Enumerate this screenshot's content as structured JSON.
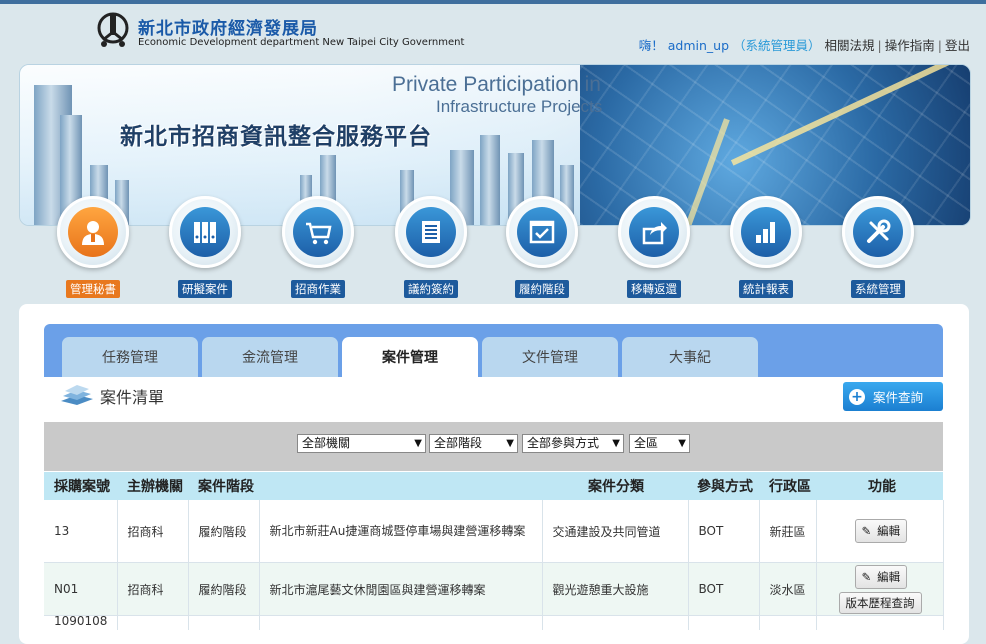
{
  "header": {
    "org_name_zh": "新北市政府經濟發展局",
    "org_name_en": "Economic Development department New Taipei City Government",
    "greeting": "嗨！",
    "username": "admin_up",
    "role": "（系統管理員）",
    "links": [
      "相關法規",
      "操作指南",
      "登出"
    ]
  },
  "banner": {
    "title_en_line1": "Private Participation in",
    "title_en_line2": "Infrastructure Projects",
    "title_zh": "新北市招商資訊整合服務平台"
  },
  "nav": {
    "items": [
      {
        "label": "管理秘書",
        "icon": "user-icon",
        "active": true
      },
      {
        "label": "研擬案件",
        "icon": "binders-icon",
        "active": false
      },
      {
        "label": "招商作業",
        "icon": "cart-icon",
        "active": false
      },
      {
        "label": "議約簽約",
        "icon": "list-icon",
        "active": false
      },
      {
        "label": "履約階段",
        "icon": "check-window-icon",
        "active": false
      },
      {
        "label": "移轉返還",
        "icon": "share-icon",
        "active": false
      },
      {
        "label": "統計報表",
        "icon": "bar-chart-icon",
        "active": false
      },
      {
        "label": "系統管理",
        "icon": "tools-icon",
        "active": false
      }
    ]
  },
  "tabs": [
    {
      "label": "任務管理"
    },
    {
      "label": "金流管理"
    },
    {
      "label": "案件管理",
      "active": true
    },
    {
      "label": "文件管理"
    },
    {
      "label": "大事紀"
    }
  ],
  "section": {
    "title": "案件清單",
    "query_button": "案件查詢"
  },
  "filters": {
    "agency": "全部機關",
    "stage": "全部階段",
    "participation": "全部參與方式",
    "district": "全區"
  },
  "table": {
    "headers": [
      "採購案號",
      "主辦機關",
      "案件階段",
      "",
      "案件分類",
      "參與方式",
      "行政區",
      "功能"
    ],
    "rows": [
      {
        "case_no": "13",
        "agency": "招商科",
        "stage": "履約階段",
        "name": "新北市新莊Au捷運商城暨停車場與建營運移轉案",
        "category": "交通建設及共同管道",
        "method": "BOT",
        "district": "新莊區",
        "actions": [
          "編輯"
        ]
      },
      {
        "case_no": "N01",
        "agency": "招商科",
        "stage": "履約階段",
        "name": "新北市滬尾藝文休閒園區與建營運移轉案",
        "category": "觀光遊憩重大設施",
        "method": "BOT",
        "district": "淡水區",
        "actions": [
          "編輯",
          "版本歷程查詢"
        ]
      },
      {
        "case_no": "1090108",
        "agency": "",
        "stage": "",
        "name": "",
        "category": "",
        "method": "",
        "district": "",
        "actions": []
      }
    ]
  },
  "colors": {
    "accent_blue": "#1d5a9c",
    "active_orange": "#e8781e",
    "tab_bar": "#6ba0e8",
    "table_header": "#bfe7f4"
  }
}
